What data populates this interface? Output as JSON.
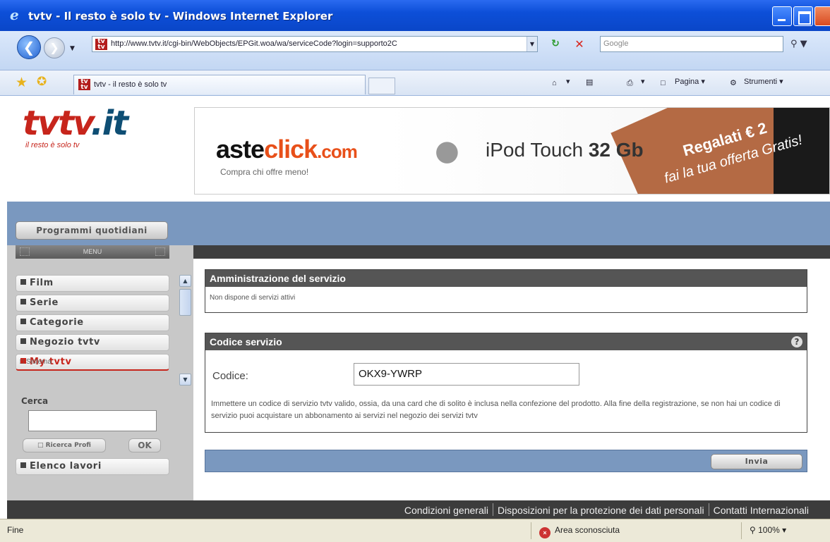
{
  "window": {
    "title": "tvtv - Il resto è solo tv - Windows Internet Explorer"
  },
  "address_bar": {
    "url": "http://www.tvtv.it/cgi-bin/WebObjects/EPGit.woa/wa/serviceCode?login=supporto2C",
    "search_placeholder": "Google"
  },
  "tab": {
    "title": "tvtv - il resto è solo tv"
  },
  "command_bar": {
    "page_label": "Pagina",
    "tools_label": "Strumenti"
  },
  "site": {
    "logo_main": "tvtv",
    "logo_tld": ".it",
    "slogan": "il resto è solo tv"
  },
  "ad": {
    "brand_a": "aste",
    "brand_b": "click",
    "brand_c": ".com",
    "tagline": "Compra chi offre meno!",
    "product_a": "iPod Touch ",
    "product_b": "32 Gb",
    "promo_line1": "Regalati € 2",
    "promo_line2": "fai la tua offerta Gratis!"
  },
  "nav": {
    "daily_programs": "Programmi quotidiani",
    "menu_title": "MENU",
    "items": [
      {
        "label": "Film"
      },
      {
        "label": "Serie"
      },
      {
        "label": "Categorie"
      },
      {
        "label": "Negozio tvtv"
      },
      {
        "label": "My tvtv"
      }
    ],
    "submenu_item": "Sistema",
    "search_label": "Cerca",
    "search_value": "",
    "profile_search_button": "Ricerca Profi",
    "ok_button": "OK",
    "job_list": "Elenco lavori"
  },
  "service_admin": {
    "heading": "Amministrazione del servizio",
    "message": "Non dispone di servizi attivi"
  },
  "service_code": {
    "heading": "Codice servizio",
    "field_label": "Codice:",
    "field_value": "OKX9-YWRP",
    "help_text": "Immettere un codice di servizio tvtv valido, ossia, da una card che di solito è inclusa nella confezione del prodotto. Alla fine della registrazione, se non hai un codice di servizio puoi acquistare un abbonamento ai servizi nel negozio dei servizi tvtv",
    "submit_button": "Invia"
  },
  "footer": {
    "links": [
      {
        "label": "Condizioni generali"
      },
      {
        "label": "Disposizioni per la protezione dei dati personali"
      },
      {
        "label": "Contatti Internazionali"
      }
    ]
  },
  "status_bar": {
    "status": "Fine",
    "zone": "Area sconosciuta",
    "zoom": "100%"
  },
  "colors": {
    "brand_red": "#c7251c",
    "brand_blue": "#0e4e74",
    "nav_blue": "#7a98bf",
    "panel_header": "#555555"
  }
}
